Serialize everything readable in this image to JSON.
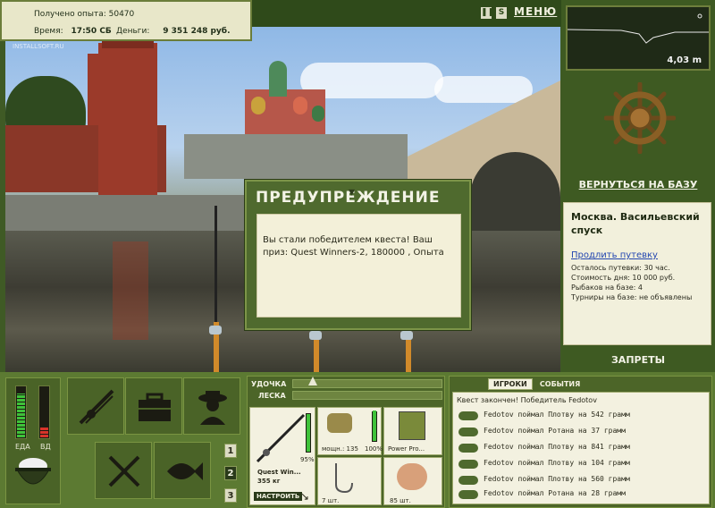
{
  "info": {
    "exp_label": "Получено опыта:",
    "exp_value": "50470",
    "time_label": "Время:",
    "time_value": "17:50 СБ",
    "money_label": "Деньги:",
    "money_value": "9 351 248 руб."
  },
  "watermark": "INSTALLSOFT.RU",
  "topbar": {
    "pause_icon": "pause-icon",
    "settings_icon": "s-icon",
    "menu_label": "МЕНЮ"
  },
  "depth": {
    "value": "4,03 m"
  },
  "dialog": {
    "title": "ПРЕДУПРЕЖДЕНИЕ",
    "message": "Вы стали победителем квеста! Ваш приз: Quest Winners-2, 180000 , Опыта"
  },
  "sidebar": {
    "return_label": "ВЕРНУТЬСЯ НА БАЗУ",
    "location": "Москва. Васильевский спуск",
    "extend_link": "Продлить путевку",
    "lines": [
      "Осталось путевки: 30 час.",
      "Стоимость дня: 10 000 руб.",
      "Рыбаков на базе: 4",
      "Турниры на базе: не объявлены"
    ],
    "bans_label": "ЗАПРЕТЫ"
  },
  "meters": {
    "food_label": "ЕДА",
    "drink_label": "ВД",
    "food_level": 0.85,
    "drink_level": 0.2
  },
  "tiles": [
    {
      "name": "rods-tile",
      "icon": "rods-icon"
    },
    {
      "name": "tackle-box-tile",
      "icon": "tackle-box-icon"
    },
    {
      "name": "fisherman-tile",
      "icon": "fisherman-icon"
    },
    {
      "name": "food-tile",
      "icon": "fork-knife-icon"
    },
    {
      "name": "fish-tile",
      "icon": "fish-icon"
    }
  ],
  "pages": [
    "1",
    "2",
    "3"
  ],
  "rod_panel": {
    "rod_label": "УДОЧКА",
    "line_label": "ЛЕСКА",
    "rod_name": "Quest Win...",
    "rod_weight": "355 кг",
    "rod_percent": "95%",
    "setup_label": "НАСТРОИТЬ",
    "reel_power": "мощн.: 135",
    "reel_percent": "100%",
    "line_name": "Power Pro...",
    "hook_count": "7 шт.",
    "bait_count": "85 шт."
  },
  "events": {
    "tab_players": "ИГРОКИ",
    "tab_events": "СОБЫТИЯ",
    "header": "Квест закончен! Победитель Fedotov",
    "rows": [
      "Fedotov поймал Плотву на 542 грамм",
      "Fedotov поймал Ротана на 37 грамм",
      "Fedotov поймал Плотву на 841 грамм",
      "Fedotov поймал Плотву на 104 грамм",
      "Fedotov поймал Плотву на 560 грамм",
      "Fedotov поймал Ротана на 28 грамм"
    ]
  }
}
